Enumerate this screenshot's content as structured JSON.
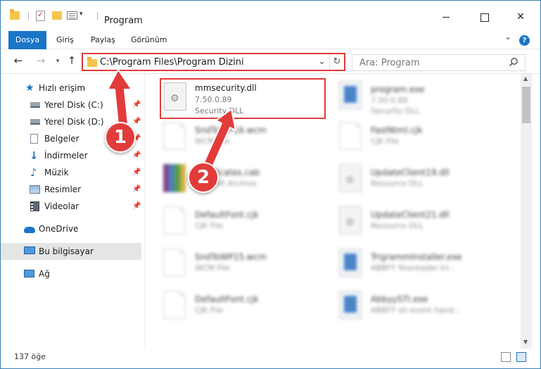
{
  "window": {
    "title": "Program"
  },
  "ribbon": {
    "tabs": [
      "Dosya",
      "Giriş",
      "Paylaş",
      "Görünüm"
    ]
  },
  "navigation": {
    "address": "C:\\Program Files\\Program Dizini",
    "search_placeholder": "Ara: Program"
  },
  "sidebar": {
    "quick_access": "Hızlı erişim",
    "items": [
      {
        "label": "Yerel Disk (C:)",
        "icon": "drive-icon",
        "pinned": true
      },
      {
        "label": "Yerel Disk (D:)",
        "icon": "drive-icon",
        "pinned": true
      },
      {
        "label": "Belgeler",
        "icon": "documents-icon",
        "pinned": true
      },
      {
        "label": "İndirmeler",
        "icon": "downloads-icon",
        "pinned": true
      },
      {
        "label": "Müzik",
        "icon": "music-icon",
        "pinned": true
      },
      {
        "label": "Resimler",
        "icon": "pictures-icon",
        "pinned": true
      },
      {
        "label": "Videolar",
        "icon": "videos-icon",
        "pinned": true
      }
    ],
    "onedrive": "OneDrive",
    "this_pc": "Bu bilgisayar",
    "network": "Ağ"
  },
  "files": {
    "selected": {
      "name": "mmsecurity.dll",
      "version": "7.50.0.89",
      "type": "Security DLL"
    },
    "others": [
      {
        "name": "program.exe",
        "line2": "7.50.0.89",
        "line3": "Security DLL"
      },
      {
        "name": "SndToWP16.wcm",
        "line2": "WCM File"
      },
      {
        "name": "FastNtml.cjk",
        "line2": "CJK File"
      },
      {
        "name": "certificates.cab",
        "line2": "WinRAR Archive"
      },
      {
        "name": "UpdateClient19.dll",
        "line2": "Resource DLL"
      },
      {
        "name": "DefaultFont.cjk",
        "line2": "CJK File"
      },
      {
        "name": "UpdateClient21.dll",
        "line2": "Resource DLL"
      },
      {
        "name": "SndToWP15.wcm",
        "line2": "WCM File"
      },
      {
        "name": "TrigrammInstaller.exe",
        "line2": "ABBYY finereader tri..."
      },
      {
        "name": "DefaultFont.cjk",
        "line2": "CJK File"
      },
      {
        "name": "AbbyySTI.exe",
        "line2": "ABBYY sti event hand..."
      }
    ]
  },
  "status": {
    "item_count": "137 öğe"
  },
  "annotations": {
    "step1": "1",
    "step2": "2"
  },
  "colors": {
    "accent": "#1b75c7",
    "highlight": "#e23b3b"
  }
}
